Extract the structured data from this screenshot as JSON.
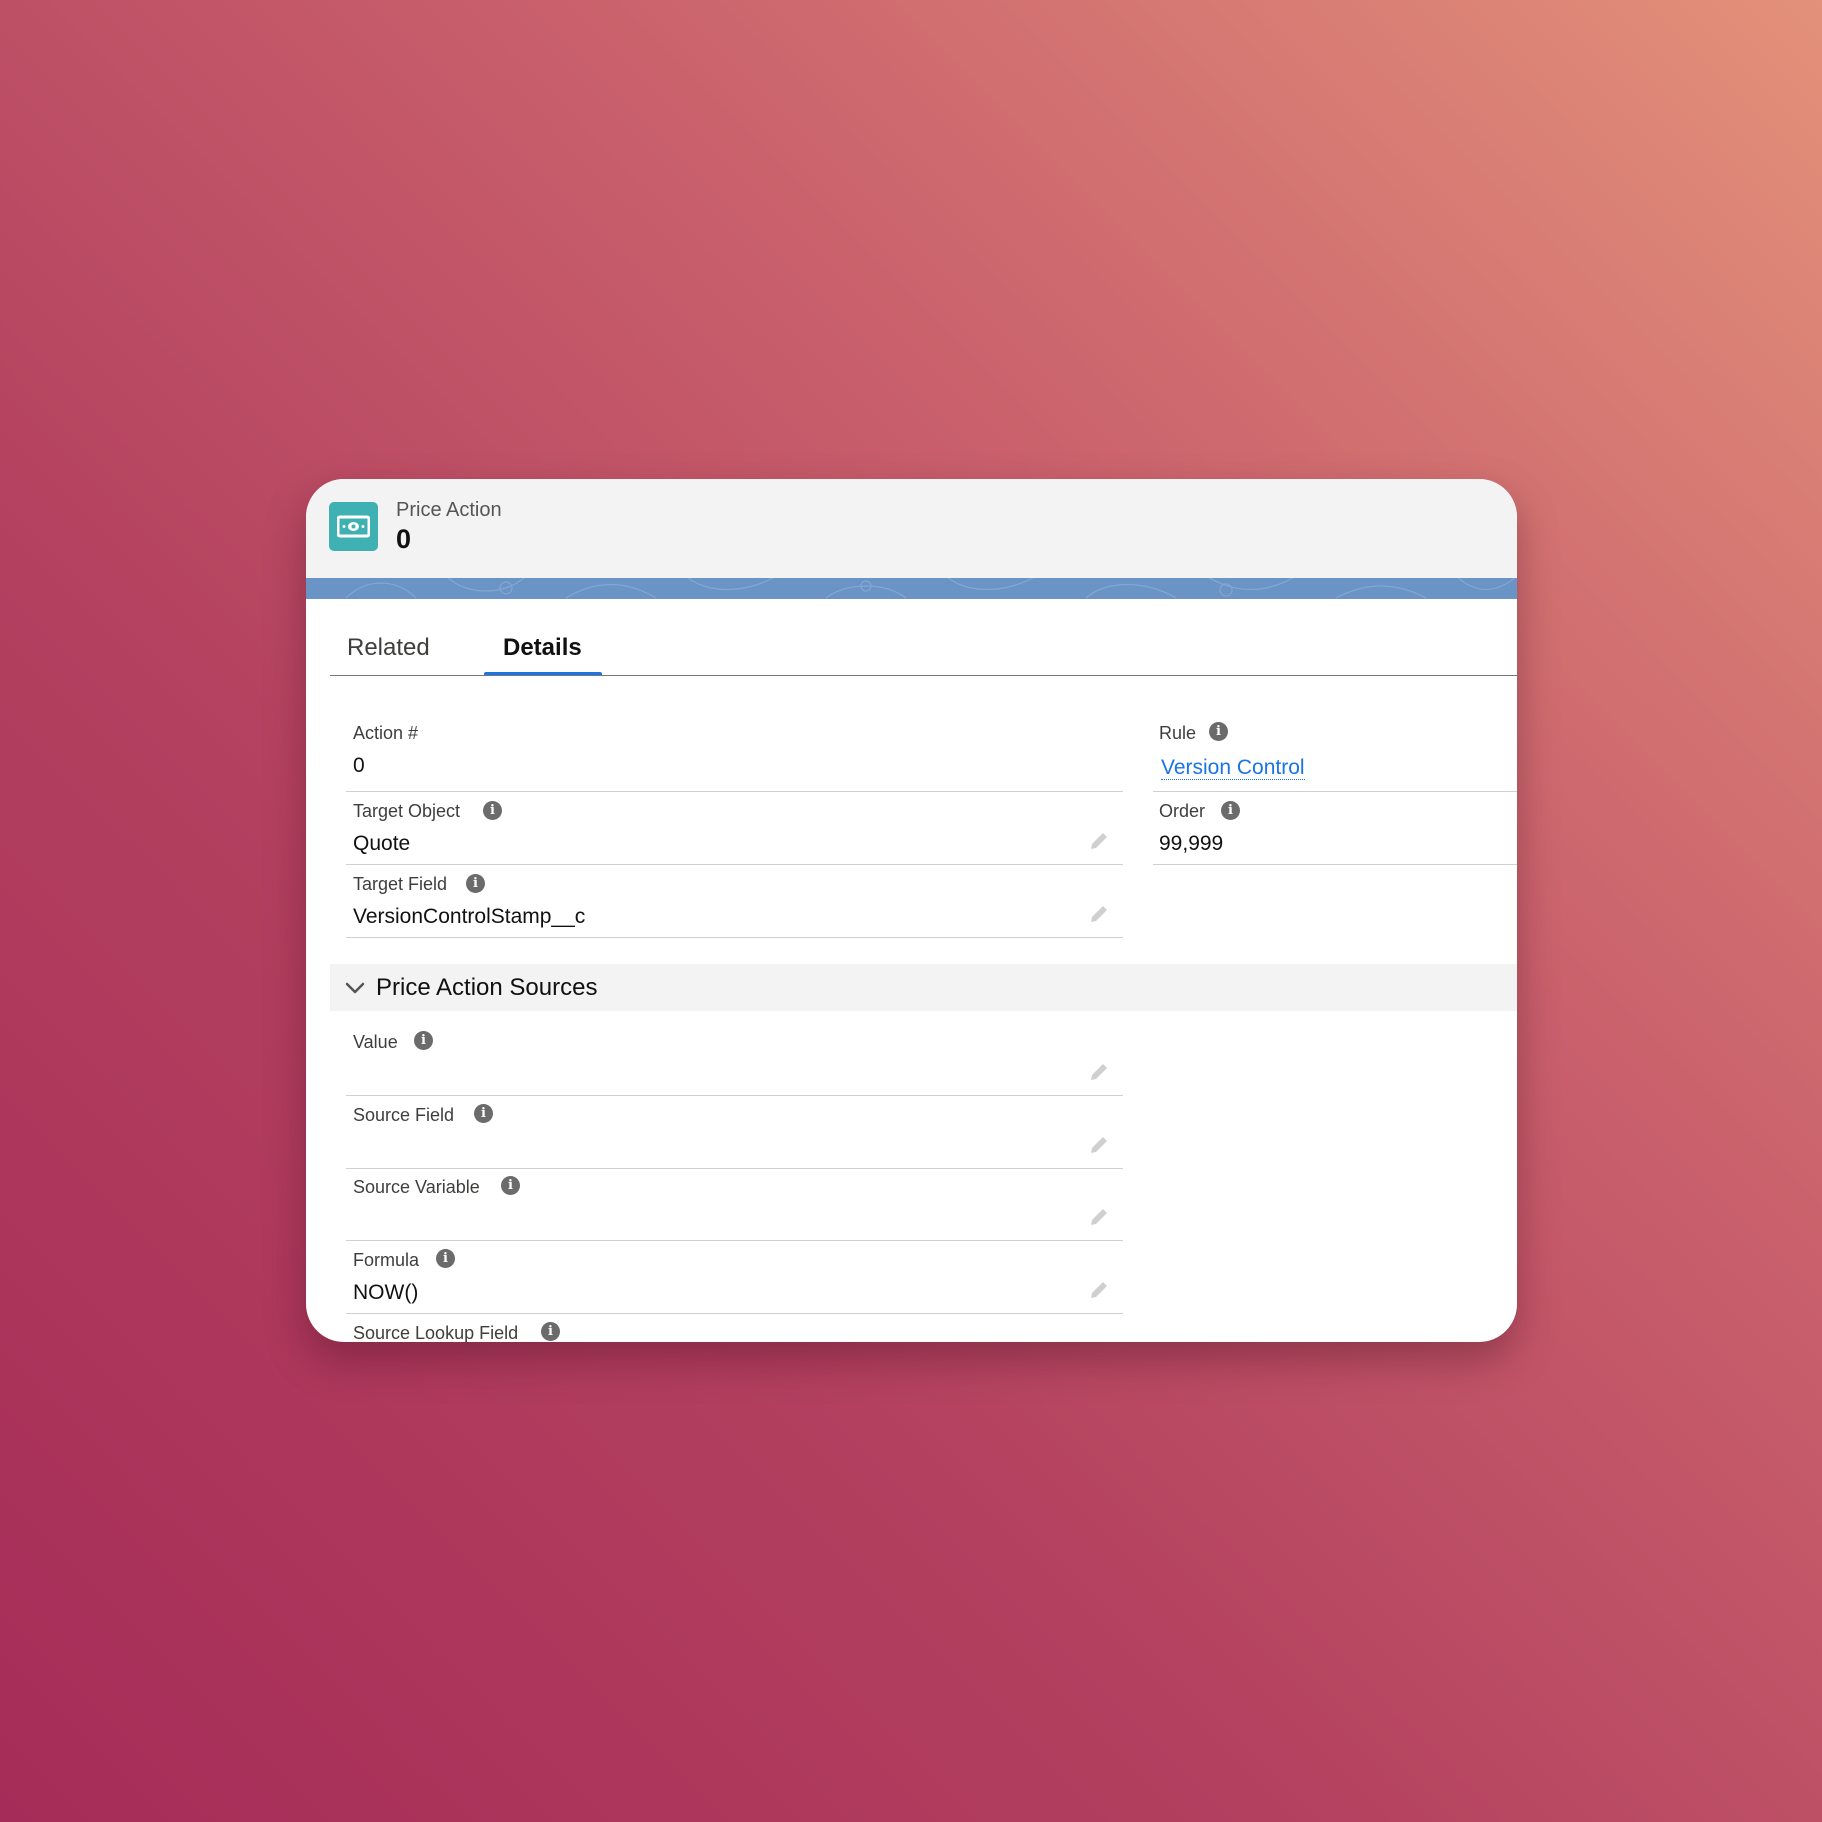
{
  "header": {
    "object_label": "Price Action",
    "record_title": "0"
  },
  "tabs": [
    {
      "label": "Related",
      "active": false
    },
    {
      "label": "Details",
      "active": true
    }
  ],
  "fields": {
    "action_number": {
      "label": "Action #",
      "value": "0"
    },
    "target_object": {
      "label": "Target Object",
      "value": "Quote"
    },
    "target_field": {
      "label": "Target Field",
      "value": "VersionControlStamp__c"
    },
    "rule": {
      "label": "Rule",
      "value": "Version Control"
    },
    "order": {
      "label": "Order",
      "value": "99,999"
    }
  },
  "section": {
    "title": "Price Action Sources",
    "fields": {
      "value": {
        "label": "Value",
        "value": ""
      },
      "source_field": {
        "label": "Source Field",
        "value": ""
      },
      "source_variable": {
        "label": "Source Variable",
        "value": ""
      },
      "formula": {
        "label": "Formula",
        "value": "NOW()"
      },
      "source_lookup_field": {
        "label": "Source Lookup Field",
        "value": ""
      }
    }
  },
  "icons": {
    "record": "money-icon",
    "info": "info-icon",
    "edit": "pencil-icon",
    "collapse": "chevron-down-icon"
  },
  "colors": {
    "record_icon": "#3fb1b3",
    "band": "#6a93c6",
    "link": "#1b74e4",
    "active_tab_underline": "#1b74e4"
  }
}
